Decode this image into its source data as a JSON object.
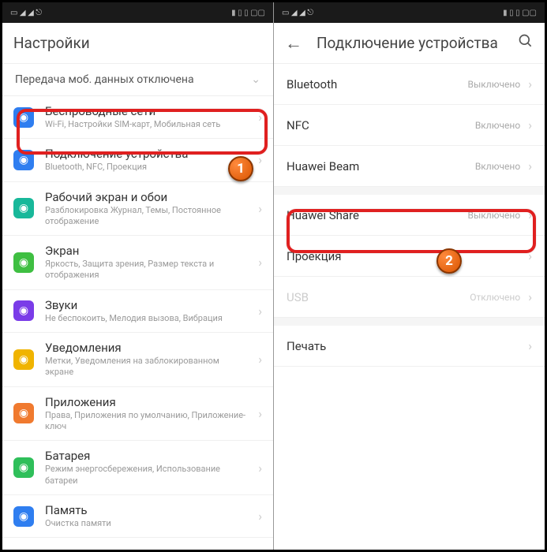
{
  "left": {
    "header": {
      "title": "Настройки"
    },
    "banner": {
      "text": "Передача моб. данных отключена"
    },
    "items": [
      {
        "icon": "wifi-icon",
        "label": "Беспроводные сети",
        "sub": "Wi-Fi, Настройки SIM-карт, Мобильная сеть",
        "color": "ic-blue"
      },
      {
        "icon": "device-icon",
        "label": "Подключение устройства",
        "sub": "Bluetooth, NFC, Проекция",
        "color": "ic-blue2"
      },
      {
        "icon": "home-icon",
        "label": "Рабочий экран и обои",
        "sub": "Разблокировка Журнал, Темы, Постоянное отображение",
        "color": "ic-teal"
      },
      {
        "icon": "display-icon",
        "label": "Экран",
        "sub": "Яркость, Защита зрения, Размер текста и отображения",
        "color": "ic-lgreen"
      },
      {
        "icon": "sound-icon",
        "label": "Звуки",
        "sub": "Не беспокоить, Мелодия вызова, Вибрация",
        "color": "ic-purple"
      },
      {
        "icon": "bell-icon",
        "label": "Уведомления",
        "sub": "Метки, Уведомления на заблокированном экране",
        "color": "ic-yellow"
      },
      {
        "icon": "apps-icon",
        "label": "Приложения",
        "sub": "Права, Приложения по умолчанию, Приложение-ключ",
        "color": "ic-orange"
      },
      {
        "icon": "battery-icon",
        "label": "Батарея",
        "sub": "Режим энергосбережения, Использование батареи",
        "color": "ic-batt"
      },
      {
        "icon": "memory-icon",
        "label": "Память",
        "sub": "Очистка памяти",
        "color": "ic-mem"
      }
    ]
  },
  "right": {
    "header": {
      "title": "Подключение устройства"
    },
    "rows": [
      {
        "label": "Bluetooth",
        "status": "Выключено"
      },
      {
        "label": "NFC",
        "status": "Включено"
      },
      {
        "label": "Huawei Beam",
        "status": "Включено"
      },
      {
        "label": "Huawei Share",
        "status": "Выключено",
        "gapBefore": true
      },
      {
        "label": "Проекция",
        "status": ""
      },
      {
        "label": "USB",
        "status": "Отключено",
        "disabled": true
      },
      {
        "label": "Печать",
        "status": "",
        "gapBefore": true
      }
    ]
  },
  "badges": {
    "one": "1",
    "two": "2"
  }
}
